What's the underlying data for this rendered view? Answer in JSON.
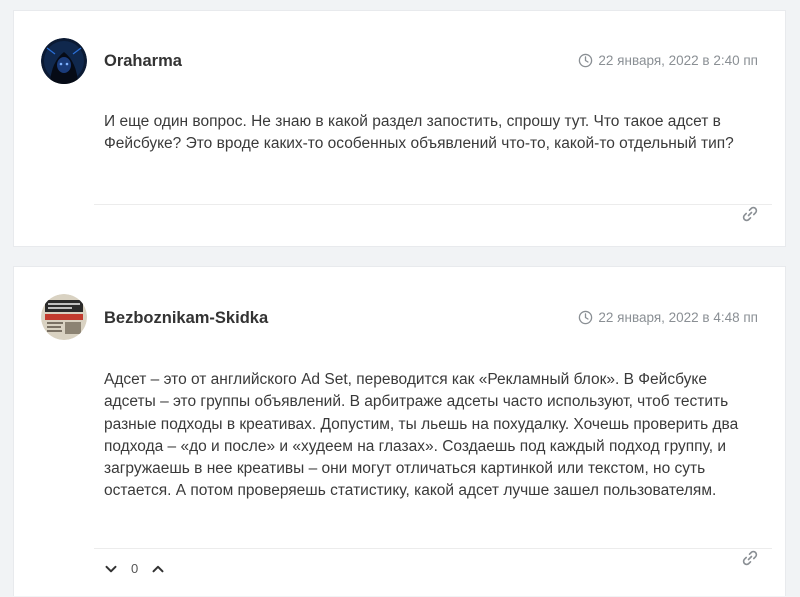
{
  "comments": [
    {
      "author": "Oraharma",
      "date": "22 января, 2022 в 2:40 пп",
      "text": "И еще один вопрос. Не знаю в какой раздел запостить, спрошу тут. Что такое адсет в Фейсбуке? Это вроде каких-то особенных объявлений что-то, какой-то отдельный тип?",
      "avatar_icon": "hooded-figure-avatar",
      "icons": {
        "date": "clock-icon",
        "share": "link-icon"
      }
    },
    {
      "author": "Bezboznikam-Skidka",
      "date": "22 января, 2022 в 4:48 пп",
      "text": "Адсет – это от английского Ad Set, переводится как «Рекламный блок». В Фейсбуке адсеты – это группы объявлений. В арбитраже адсеты часто используют, чтоб тестить разные подходы в креативах. Допустим, ты льешь на похудалку. Хочешь проверить два подхода – «до и после» и «худеем на глазах». Создаешь под каждый подход группу, и загружаешь в нее креативы – они могут отличаться картинкой или текстом, но суть остается. А потом проверяешь статистику, какой адсет лучше зашел пользователям.",
      "avatar_icon": "newspaper-avatar",
      "votes": {
        "count": "0",
        "down_icon": "chevron-down-icon",
        "up_icon": "chevron-up-icon"
      },
      "icons": {
        "date": "clock-icon",
        "share": "link-icon"
      }
    }
  ],
  "colors": {
    "background": "#f1f3f5",
    "card": "#ffffff",
    "meta": "#8a8f94",
    "text": "#3a3a3a"
  }
}
